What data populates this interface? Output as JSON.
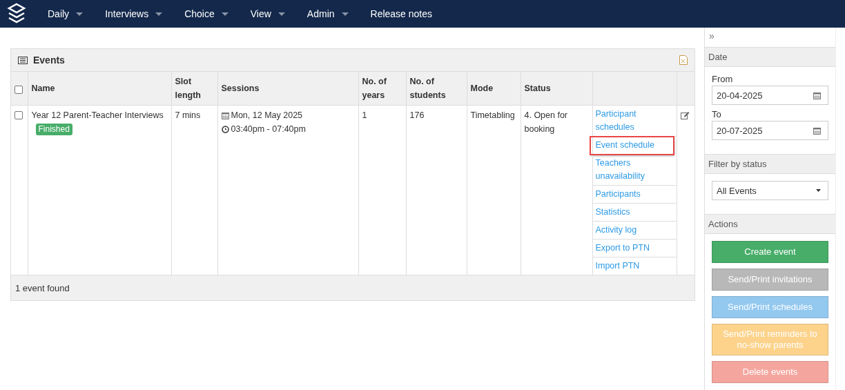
{
  "nav": {
    "items": [
      {
        "label": "Daily",
        "dropdown": true
      },
      {
        "label": "Interviews",
        "dropdown": true
      },
      {
        "label": "Choice",
        "dropdown": true
      },
      {
        "label": "View",
        "dropdown": true
      },
      {
        "label": "Admin",
        "dropdown": true
      },
      {
        "label": "Release notes",
        "dropdown": false
      }
    ]
  },
  "events_panel": {
    "title": "Events",
    "table": {
      "columns": [
        "Name",
        "Slot length",
        "Sessions",
        "No. of years",
        "No. of students",
        "Mode",
        "Status"
      ],
      "header_checked": false,
      "rows": [
        {
          "checked": false,
          "name": "Year 12 Parent-Teacher Interviews",
          "badge": "Finished",
          "slot_length": "7 mins",
          "session_date": "Mon, 12 May 2025",
          "session_time": "03:40pm - 07:40pm",
          "years": "1",
          "students": "176",
          "mode": "Timetabling",
          "status": "4. Open for booking",
          "links": [
            {
              "label": "Participant schedules",
              "highlighted": false
            },
            {
              "label": "Event schedule",
              "highlighted": true
            },
            {
              "label": "Teachers unavailability",
              "highlighted": false
            },
            {
              "label": "Participants",
              "highlighted": false
            },
            {
              "label": "Statistics",
              "highlighted": false
            },
            {
              "label": "Activity log",
              "highlighted": false
            },
            {
              "label": "Export to PTN",
              "highlighted": false
            },
            {
              "label": "Import PTN",
              "highlighted": false
            }
          ]
        }
      ]
    },
    "footer": "1 event found"
  },
  "sidebar": {
    "collapse": "»",
    "date": {
      "title": "Date",
      "from_label": "From",
      "from_value": "20-04-2025",
      "to_label": "To",
      "to_value": "20-07-2025"
    },
    "filter": {
      "title": "Filter by status",
      "value": "All Events"
    },
    "actions": {
      "title": "Actions",
      "buttons": [
        {
          "label": "Create event",
          "color": "#47ad69"
        },
        {
          "label": "Send/Print invitations",
          "color": "#b8b8b8"
        },
        {
          "label": "Send/Print schedules",
          "color": "#93c8ef"
        },
        {
          "label": "Send/Print reminders to no-show parents",
          "color": "#fdd38c"
        },
        {
          "label": "Delete events",
          "color": "#f4a69e"
        }
      ]
    }
  }
}
